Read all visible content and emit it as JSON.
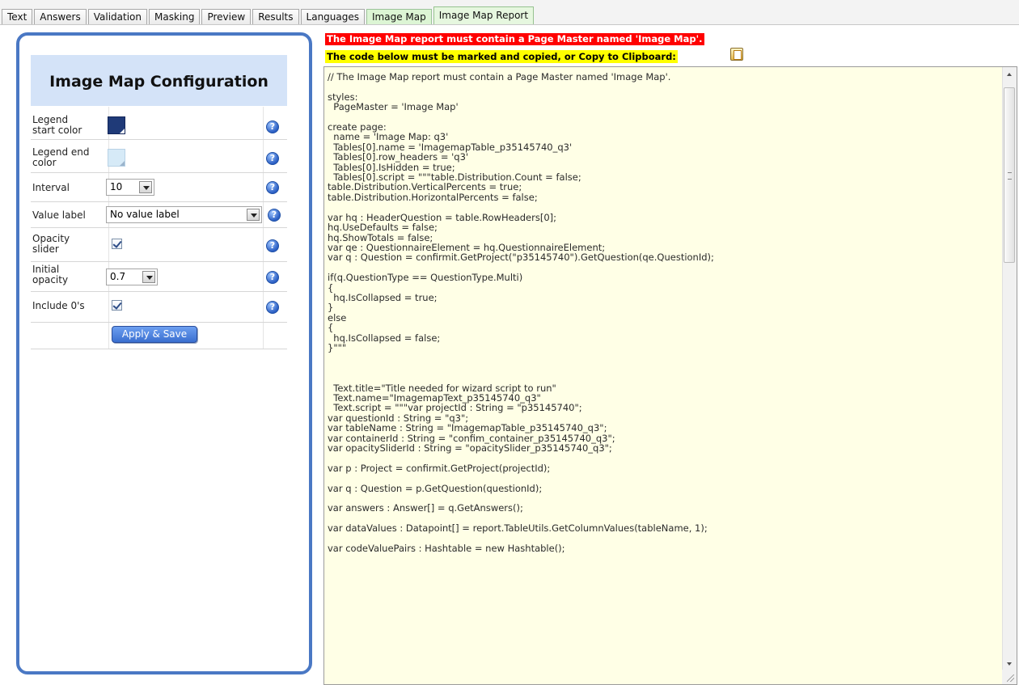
{
  "tabs": [
    {
      "label": "Text"
    },
    {
      "label": "Answers"
    },
    {
      "label": "Validation"
    },
    {
      "label": "Masking"
    },
    {
      "label": "Preview"
    },
    {
      "label": "Results"
    },
    {
      "label": "Languages"
    },
    {
      "label": "Image Map"
    },
    {
      "label": "Image Map Report"
    }
  ],
  "config": {
    "title": "Image Map Configuration",
    "legend_start_label": "Legend\nstart color",
    "legend_start_color": "#1f3a78",
    "legend_end_label": "Legend end\ncolor",
    "legend_end_color": "#d6eaf7",
    "interval_label": "Interval",
    "interval_value": "10",
    "value_label_label": "Value label",
    "value_label_value": "No value label",
    "opacity_slider_label": "Opacity\nslider",
    "opacity_slider_checked": true,
    "initial_opacity_label": "Initial\nopacity",
    "initial_opacity_value": "0.7",
    "include_zeros_label": "Include 0's",
    "include_zeros_checked": true,
    "help_glyph": "?",
    "apply_button_label": "Apply & Save"
  },
  "notices": {
    "red": "The Image Map report must contain a Page Master named 'Image Map'.",
    "yellow": "The code below must be marked and copied, or Copy to Clipboard:"
  },
  "code": "// The Image Map report must contain a Page Master named 'Image Map'.\n\nstyles:\n  PageMaster = 'Image Map'\n\ncreate page:\n  name = 'Image Map: q3'\n  Tables[0].name = 'ImagemapTable_p35145740_q3'\n  Tables[0].row_headers = 'q3'\n  Tables[0].IsHidden = true;\n  Tables[0].script = \"\"\"table.Distribution.Count = false;\ntable.Distribution.VerticalPercents = true;\ntable.Distribution.HorizontalPercents = false;\n\nvar hq : HeaderQuestion = table.RowHeaders[0];\nhq.UseDefaults = false;\nhq.ShowTotals = false;\nvar qe : QuestionnaireElement = hq.QuestionnaireElement;\nvar q : Question = confirmit.GetProject(\"p35145740\").GetQuestion(qe.QuestionId);\n\nif(q.QuestionType == QuestionType.Multi)\n{\n  hq.IsCollapsed = true;\n}\nelse\n{\n  hq.IsCollapsed = false;\n}\"\"\"\n\n\n\n  Text.title=\"Title needed for wizard script to run\"\n  Text.name=\"ImagemapText_p35145740_q3\"\n  Text.script = \"\"\"var projectId : String = \"p35145740\";\nvar questionId : String = \"q3\";\nvar tableName : String = \"ImagemapTable_p35145740_q3\";\nvar containerId : String = \"confim_container_p35145740_q3\";\nvar opacitySliderId : String = \"opacitySlider_p35145740_q3\";\n\nvar p : Project = confirmit.GetProject(projectId);\n\nvar q : Question = p.GetQuestion(questionId);\n\nvar answers : Answer[] = q.GetAnswers();\n\nvar dataValues : Datapoint[] = report.TableUtils.GetColumnValues(tableName, 1);\n\nvar codeValuePairs : Hashtable = new Hashtable();"
}
